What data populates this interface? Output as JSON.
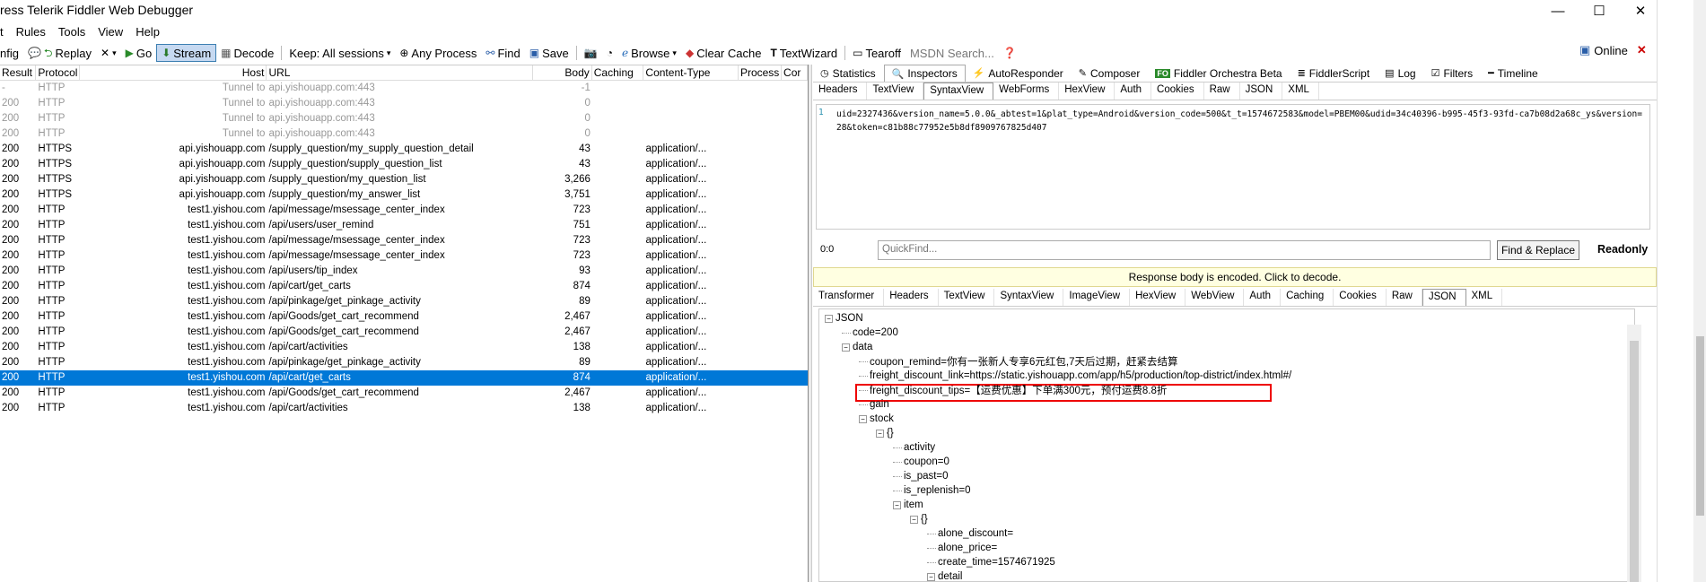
{
  "window": {
    "title": "ress Telerik Fiddler Web Debugger",
    "min": "—",
    "max": "☐",
    "close": "✕"
  },
  "menu": [
    "t",
    "Rules",
    "Tools",
    "View",
    "Help"
  ],
  "toolbar": {
    "config": "nfig",
    "replay": "Replay",
    "remove_caret": "▾",
    "go": "Go",
    "stream": "Stream",
    "decode": "Decode",
    "keep": "Keep: All sessions",
    "any_process": "Any Process",
    "find": "Find",
    "save": "Save",
    "browse": "Browse",
    "clear_cache": "Clear Cache",
    "text_wizard": "TextWizard",
    "tearoff": "Tearoff",
    "msdn_placeholder": "MSDN Search...",
    "online": "Online"
  },
  "sessions": {
    "columns": [
      "Result",
      "Protocol",
      "Host",
      "URL",
      "Body",
      "Caching",
      "Content-Type",
      "Process",
      "Cor"
    ],
    "rows": [
      {
        "result": "-",
        "protocol": "HTTP",
        "host": "Tunnel to",
        "url": "api.yishouapp.com:443",
        "body": "-1",
        "caching": "",
        "ct": "",
        "tunnel": true
      },
      {
        "result": "200",
        "protocol": "HTTP",
        "host": "Tunnel to",
        "url": "api.yishouapp.com:443",
        "body": "0",
        "caching": "",
        "ct": "",
        "tunnel": true
      },
      {
        "result": "200",
        "protocol": "HTTP",
        "host": "Tunnel to",
        "url": "api.yishouapp.com:443",
        "body": "0",
        "caching": "",
        "ct": "",
        "tunnel": true
      },
      {
        "result": "200",
        "protocol": "HTTP",
        "host": "Tunnel to",
        "url": "api.yishouapp.com:443",
        "body": "0",
        "caching": "",
        "ct": "",
        "tunnel": true
      },
      {
        "result": "200",
        "protocol": "HTTPS",
        "host": "api.yishouapp.com",
        "url": "/supply_question/my_supply_question_detail",
        "body": "43",
        "caching": "",
        "ct": "application/..."
      },
      {
        "result": "200",
        "protocol": "HTTPS",
        "host": "api.yishouapp.com",
        "url": "/supply_question/supply_question_list",
        "body": "43",
        "caching": "",
        "ct": "application/..."
      },
      {
        "result": "200",
        "protocol": "HTTPS",
        "host": "api.yishouapp.com",
        "url": "/supply_question/my_question_list",
        "body": "3,266",
        "caching": "",
        "ct": "application/..."
      },
      {
        "result": "200",
        "protocol": "HTTPS",
        "host": "api.yishouapp.com",
        "url": "/supply_question/my_answer_list",
        "body": "3,751",
        "caching": "",
        "ct": "application/..."
      },
      {
        "result": "200",
        "protocol": "HTTP",
        "host": "test1.yishou.com",
        "url": "/api/message/msessage_center_index",
        "body": "723",
        "caching": "",
        "ct": "application/..."
      },
      {
        "result": "200",
        "protocol": "HTTP",
        "host": "test1.yishou.com",
        "url": "/api/users/user_remind",
        "body": "751",
        "caching": "",
        "ct": "application/..."
      },
      {
        "result": "200",
        "protocol": "HTTP",
        "host": "test1.yishou.com",
        "url": "/api/message/msessage_center_index",
        "body": "723",
        "caching": "",
        "ct": "application/..."
      },
      {
        "result": "200",
        "protocol": "HTTP",
        "host": "test1.yishou.com",
        "url": "/api/message/msessage_center_index",
        "body": "723",
        "caching": "",
        "ct": "application/..."
      },
      {
        "result": "200",
        "protocol": "HTTP",
        "host": "test1.yishou.com",
        "url": "/api/users/tip_index",
        "body": "93",
        "caching": "",
        "ct": "application/..."
      },
      {
        "result": "200",
        "protocol": "HTTP",
        "host": "test1.yishou.com",
        "url": "/api/cart/get_carts",
        "body": "874",
        "caching": "",
        "ct": "application/..."
      },
      {
        "result": "200",
        "protocol": "HTTP",
        "host": "test1.yishou.com",
        "url": "/api/pinkage/get_pinkage_activity",
        "body": "89",
        "caching": "",
        "ct": "application/..."
      },
      {
        "result": "200",
        "protocol": "HTTP",
        "host": "test1.yishou.com",
        "url": "/api/Goods/get_cart_recommend",
        "body": "2,467",
        "caching": "",
        "ct": "application/..."
      },
      {
        "result": "200",
        "protocol": "HTTP",
        "host": "test1.yishou.com",
        "url": "/api/Goods/get_cart_recommend",
        "body": "2,467",
        "caching": "",
        "ct": "application/..."
      },
      {
        "result": "200",
        "protocol": "HTTP",
        "host": "test1.yishou.com",
        "url": "/api/cart/activities",
        "body": "138",
        "caching": "",
        "ct": "application/..."
      },
      {
        "result": "200",
        "protocol": "HTTP",
        "host": "test1.yishou.com",
        "url": "/api/pinkage/get_pinkage_activity",
        "body": "89",
        "caching": "",
        "ct": "application/..."
      },
      {
        "result": "200",
        "protocol": "HTTP",
        "host": "test1.yishou.com",
        "url": "/api/cart/get_carts",
        "body": "874",
        "caching": "",
        "ct": "application/...",
        "selected": true
      },
      {
        "result": "200",
        "protocol": "HTTP",
        "host": "test1.yishou.com",
        "url": "/api/Goods/get_cart_recommend",
        "body": "2,467",
        "caching": "",
        "ct": "application/..."
      },
      {
        "result": "200",
        "protocol": "HTTP",
        "host": "test1.yishou.com",
        "url": "/api/cart/activities",
        "body": "138",
        "caching": "",
        "ct": "application/..."
      }
    ]
  },
  "inspector": {
    "main_tabs": [
      {
        "label": "Statistics",
        "icon": "stopwatch-icon",
        "glyph": "◷"
      },
      {
        "label": "Inspectors",
        "icon": "inspect-icon",
        "glyph": "🔍",
        "active": true
      },
      {
        "label": "AutoResponder",
        "icon": "lightning-icon",
        "glyph": "⚡"
      },
      {
        "label": "Composer",
        "icon": "composer-icon",
        "glyph": "✎"
      },
      {
        "label": "Fiddler Orchestra Beta",
        "icon": "fo-icon",
        "glyph": "FO"
      },
      {
        "label": "FiddlerScript",
        "icon": "script-icon",
        "glyph": "≣"
      },
      {
        "label": "Log",
        "icon": "log-icon",
        "glyph": "▤"
      },
      {
        "label": "Filters",
        "icon": "checkbox-icon",
        "glyph": "☑"
      },
      {
        "label": "Timeline",
        "icon": "timeline-icon",
        "glyph": "━"
      }
    ],
    "request_tabs": [
      "Headers",
      "TextView",
      "SyntaxView",
      "WebForms",
      "HexView",
      "Auth",
      "Cookies",
      "Raw",
      "JSON",
      "XML"
    ],
    "request_active": "SyntaxView",
    "line_number": "1",
    "request_body": "uid=2327436&version_name=5.0.0&_abtest=1&plat_type=Android&version_code=500&t_t=1574672583&model=PBEM00&udid=34c40396-b995-45f3-93fd-ca7b08d2a68c_ys&version=28&token=c81b88c77952e5b8df8909767825d407",
    "pos": "0:0",
    "quickfind_placeholder": "QuickFind...",
    "find_replace": "Find & Replace",
    "readonly": "Readonly",
    "encoded_notice": "Response body is encoded. Click to decode.",
    "response_tabs": [
      "Transformer",
      "Headers",
      "TextView",
      "SyntaxView",
      "ImageView",
      "HexView",
      "WebView",
      "Auth",
      "Caching",
      "Cookies",
      "Raw",
      "JSON",
      "XML"
    ],
    "response_active": "JSON"
  },
  "json_tree": [
    {
      "text": "JSON",
      "depth": 0,
      "exp": "−"
    },
    {
      "text": "code=200",
      "depth": 1
    },
    {
      "text": "data",
      "depth": 1,
      "exp": "−"
    },
    {
      "text": "coupon_remind=你有一张新人专享6元红包,7天后过期，赶紧去结算",
      "depth": 2
    },
    {
      "text": "freight_discount_link=https://static.yishouapp.com/app/h5/production/top-district/index.html#/",
      "depth": 2
    },
    {
      "text": "freight_discount_tips=【运费优惠】下单满300元，预付运费8.8折",
      "depth": 2
    },
    {
      "text": "gain",
      "depth": 2
    },
    {
      "text": "stock",
      "depth": 2,
      "exp": "−"
    },
    {
      "text": "{}",
      "depth": 3,
      "exp": "−"
    },
    {
      "text": "activity",
      "depth": 4
    },
    {
      "text": "coupon=0",
      "depth": 4
    },
    {
      "text": "is_past=0",
      "depth": 4
    },
    {
      "text": "is_replenish=0",
      "depth": 4
    },
    {
      "text": "item",
      "depth": 4,
      "exp": "−"
    },
    {
      "text": "{}",
      "depth": 5,
      "exp": "−"
    },
    {
      "text": "alone_discount=",
      "depth": 6
    },
    {
      "text": "alone_price=",
      "depth": 6
    },
    {
      "text": "create_time=1574671925",
      "depth": 6
    },
    {
      "text": "detail",
      "depth": 6,
      "exp": "−"
    }
  ]
}
